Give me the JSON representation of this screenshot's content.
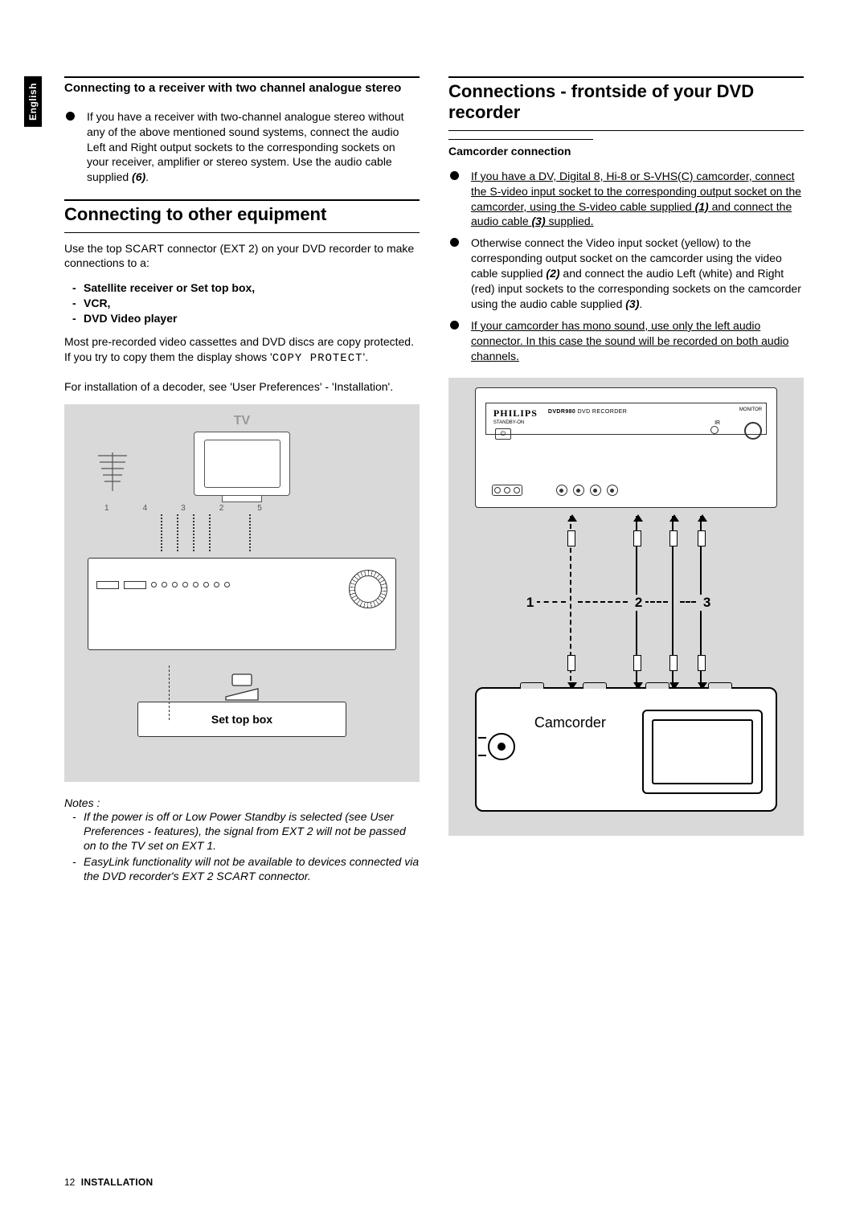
{
  "sideTab": "English",
  "left": {
    "section1": {
      "title": "Connecting to a receiver with two channel analogue stereo",
      "bullet1_pre": "If you have a receiver with two-channel analogue stereo without any of the above mentioned sound systems, connect the audio Left and Right output sockets to the corresponding sockets on your receiver, amplifier or stereo system. Use the audio cable supplied ",
      "bullet1_bold": "(6)",
      "bullet1_post": "."
    },
    "section2": {
      "heading": "Connecting to other equipment",
      "para1_pre": "Use the top ",
      "para1_sc": "SCART",
      "para1_post": " connector (EXT 2) on your DVD recorder to make connections to a:",
      "list": {
        "l1": "Satellite receiver or Set top box,",
        "l2": "VCR,",
        "l3": "DVD Video player"
      },
      "para2_pre": "Most pre-recorded video cassettes and DVD discs are copy protected. If you try to copy them the display shows '",
      "para2_mono": "COPY PROTECT",
      "para2_post": "'.",
      "para3": "For installation of a decoder, see 'User Preferences' - 'Installation'."
    },
    "figure": {
      "tvLabel": "TV",
      "cableNums": [
        "1",
        "4",
        "3",
        "2",
        "5"
      ],
      "stb": "Set top box"
    },
    "notes": {
      "title": "Notes :",
      "n1": "If the power is off or Low Power Standby is selected (see User Preferences - features), the signal from EXT 2 will not be passed on to the TV set on EXT 1.",
      "n2_pre": "EasyLink functionality will not be available to devices connected via the DVD recorder's EXT 2 ",
      "n2_sc": "SCART",
      "n2_post": " connector."
    }
  },
  "right": {
    "heading": "Connections - frontside of your DVD recorder",
    "subheading": "Camcorder connection",
    "b1_pre": "If you have a DV, Digital 8, Hi-8 or S-VHS(C) camcorder, connect the S-video input socket to the corresponding output socket on the camcorder, using the S-video cable supplied ",
    "b1_bold1": "(1)",
    "b1_mid": " and connect the audio cable ",
    "b1_bold2": "(3)",
    "b1_post": " supplied.",
    "b2_pre": "Otherwise connect the Video input socket (yellow) to the corresponding output socket on the camcorder using the video cable supplied ",
    "b2_bold1": "(2)",
    "b2_mid": " and connect the audio Left (white) and Right (red) input sockets to the corresponding sockets on the camcorder using the audio cable supplied ",
    "b2_bold2": "(3)",
    "b2_post": ".",
    "b3": "If your camcorder has mono sound, use only the left audio connector. In this case the sound will be recorded on both audio channels.",
    "figure": {
      "brand": "PHILIPS",
      "model": "DVDR980",
      "modelSuffix": "DVD RECORDER",
      "standby": "STANDBY-ON",
      "ir": "IR",
      "monitor": "MONITOR",
      "plugLabels": {
        "p1": "1",
        "p2": "2",
        "p3": "3"
      },
      "camLabel": "Camcorder"
    }
  },
  "footer": {
    "page": "12",
    "section": "INSTALLATION"
  }
}
